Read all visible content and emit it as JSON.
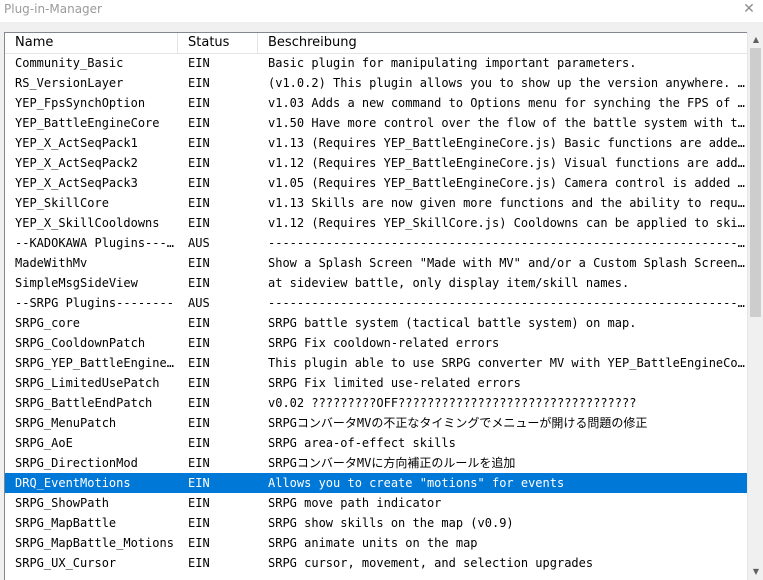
{
  "window": {
    "title": "Plug-in-Manager",
    "close_glyph": "✕"
  },
  "columns": {
    "name": "Name",
    "status": "Status",
    "description": "Beschreibung"
  },
  "rows": [
    {
      "name": "Community_Basic",
      "status": "EIN",
      "desc": "Basic plugin for manipulating important parameters."
    },
    {
      "name": "RS_VersionLayer",
      "status": "EIN",
      "desc": "(v1.0.2) This plugin allows you to show up the version anywhere. <RS…"
    },
    {
      "name": "YEP_FpsSynchOption",
      "status": "EIN",
      "desc": "v1.03 Adds a new command to Options menu for synching the FPS of mon…"
    },
    {
      "name": "YEP_BattleEngineCore",
      "status": "EIN",
      "desc": "v1.50 Have more control over the flow of the battle system with this…"
    },
    {
      "name": "YEP_X_ActSeqPack1",
      "status": "EIN",
      "desc": "v1.13 (Requires YEP_BattleEngineCore.js) Basic functions are added t…"
    },
    {
      "name": "YEP_X_ActSeqPack2",
      "status": "EIN",
      "desc": "v1.12 (Requires YEP_BattleEngineCore.js) Visual functions are added …"
    },
    {
      "name": "YEP_X_ActSeqPack3",
      "status": "EIN",
      "desc": "v1.05 (Requires YEP_BattleEngineCore.js) Camera control is added to …"
    },
    {
      "name": "YEP_SkillCore",
      "status": "EIN",
      "desc": "v1.13 Skills are now given more functions and the ability to require…"
    },
    {
      "name": "YEP_X_SkillCooldowns",
      "status": "EIN",
      "desc": "v1.12 (Requires YEP_SkillCore.js) Cooldowns can be applied to skills…"
    },
    {
      "name": "--KADOKAWA Plugins-----",
      "status": "AUS",
      "desc": "----------------------------------------------------------------------"
    },
    {
      "name": "MadeWithMv",
      "status": "EIN",
      "desc": "Show a Splash Screen \"Made with MV\" and/or a Custom Splash Screen be…"
    },
    {
      "name": "SimpleMsgSideView",
      "status": "EIN",
      "desc": "at sideview battle, only display item/skill names."
    },
    {
      "name": "--SRPG Plugins--------",
      "status": "AUS",
      "desc": "----------------------------------------------------------------------"
    },
    {
      "name": "SRPG_core",
      "status": "EIN",
      "desc": "SRPG battle system (tactical battle system) on map."
    },
    {
      "name": "SRPG_CooldownPatch",
      "status": "EIN",
      "desc": "SRPG Fix cooldown-related errors"
    },
    {
      "name": "SRPG_YEP_BattleEngine…",
      "status": "EIN",
      "desc": "This plugin able to use SRPG converter MV with YEP_BattleEngineCore.…"
    },
    {
      "name": "SRPG_LimitedUsePatch",
      "status": "EIN",
      "desc": "SRPG Fix limited use-related errors"
    },
    {
      "name": "SRPG_BattleEndPatch",
      "status": "EIN",
      "desc": "v0.02 ?????????OFF?????????????????????????????????"
    },
    {
      "name": "SRPG_MenuPatch",
      "status": "EIN",
      "desc": "SRPGコンバータMVの不正なタイミングでメニューが開ける問題の修正"
    },
    {
      "name": "SRPG_AoE",
      "status": "EIN",
      "desc": "SRPG area-of-effect skills"
    },
    {
      "name": "SRPG_DirectionMod",
      "status": "EIN",
      "desc": "SRPGコンバータMVに方向補正のルールを追加"
    },
    {
      "name": "DRQ_EventMotions",
      "status": "EIN",
      "desc": "Allows you to create \"motions\" for events",
      "selected": true
    },
    {
      "name": "SRPG_ShowPath",
      "status": "EIN",
      "desc": "SRPG move path indicator"
    },
    {
      "name": "SRPG_MapBattle",
      "status": "EIN",
      "desc": "SRPG show skills on the map (v0.9)"
    },
    {
      "name": "SRPG_MapBattle_Motions",
      "status": "EIN",
      "desc": "SRPG animate units on the map"
    },
    {
      "name": "SRPG_UX_Cursor",
      "status": "EIN",
      "desc": "SRPG cursor, movement, and selection upgrades"
    }
  ],
  "scrollbar": {
    "up_glyph": "▲",
    "down_glyph": "▼"
  }
}
